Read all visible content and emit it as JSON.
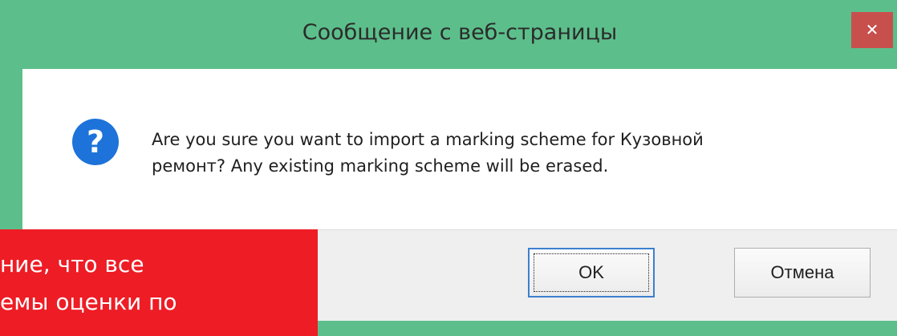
{
  "dialog": {
    "title": "Сообщение с веб-страницы",
    "close_glyph": "✕",
    "icon": "question-icon",
    "icon_glyph": "?",
    "message_line1": "Are you sure you want to import a marking scheme for Кузовной",
    "message_line2": "ремонт? Any existing marking scheme will be erased.",
    "ok_label": "OK",
    "cancel_label": "Отмена"
  },
  "overlay": {
    "line1": "ние, что все",
    "line2": "емы оценки по"
  },
  "colors": {
    "titlebar": "#5cbf8b",
    "close": "#c7504d",
    "icon": "#1d73d9",
    "overlay": "#ee1c25"
  }
}
